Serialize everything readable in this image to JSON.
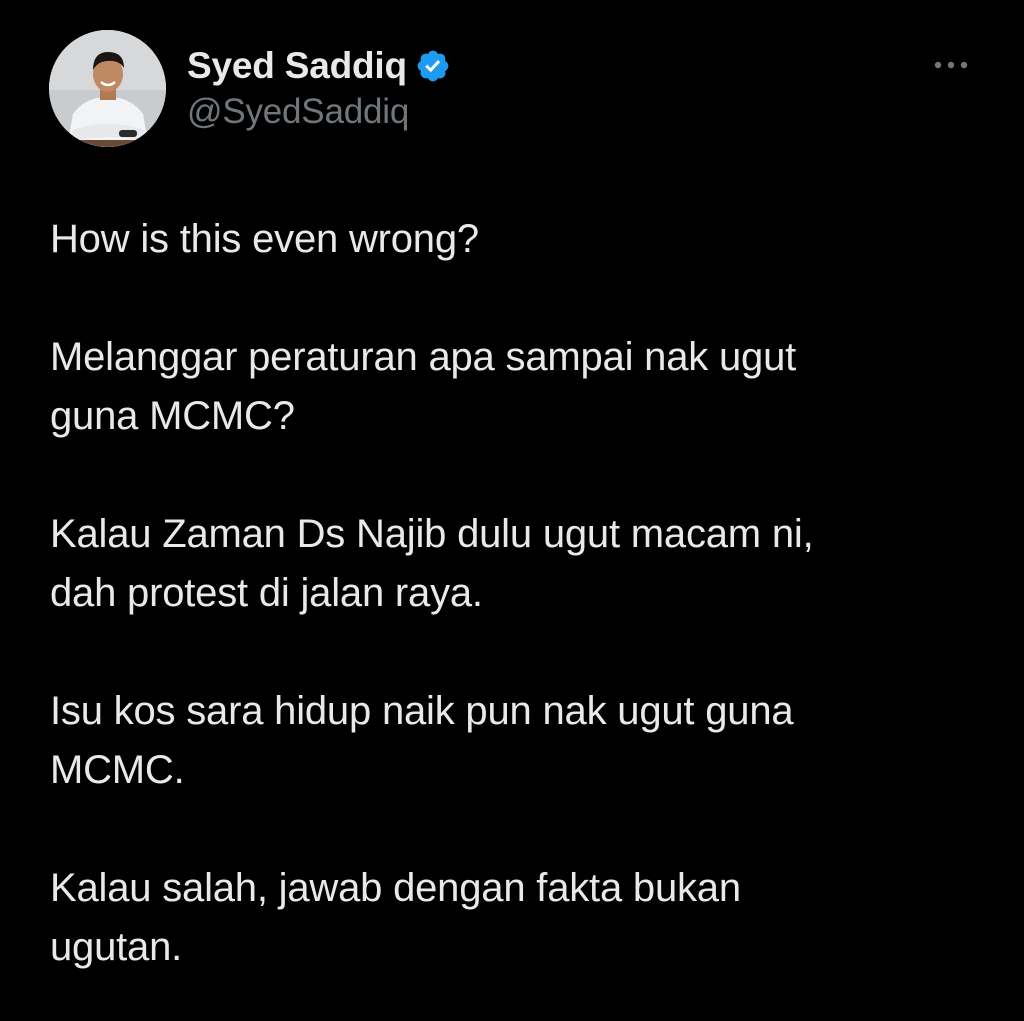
{
  "author": {
    "name": "Syed Saddiq",
    "handle": "@SyedSaddiq",
    "verified": true,
    "verified_color": "#1d9bf0",
    "avatar_icon": "avatar-photo"
  },
  "actions": {
    "more_icon": "ellipsis-icon"
  },
  "tweet": {
    "paragraphs": [
      "How is this even wrong?",
      "Melanggar peraturan apa sampai nak ugut\nguna MCMC?",
      "Kalau Zaman Ds Najib dulu ugut macam ni,\ndah protest di jalan raya.",
      "Isu kos sara hidup naik pun nak ugut guna\nMCMC.",
      "Kalau salah, jawab dengan fakta bukan\nugutan."
    ]
  },
  "colors": {
    "background": "#000000",
    "text": "#e7e9ea",
    "secondary_text": "#71767b"
  }
}
